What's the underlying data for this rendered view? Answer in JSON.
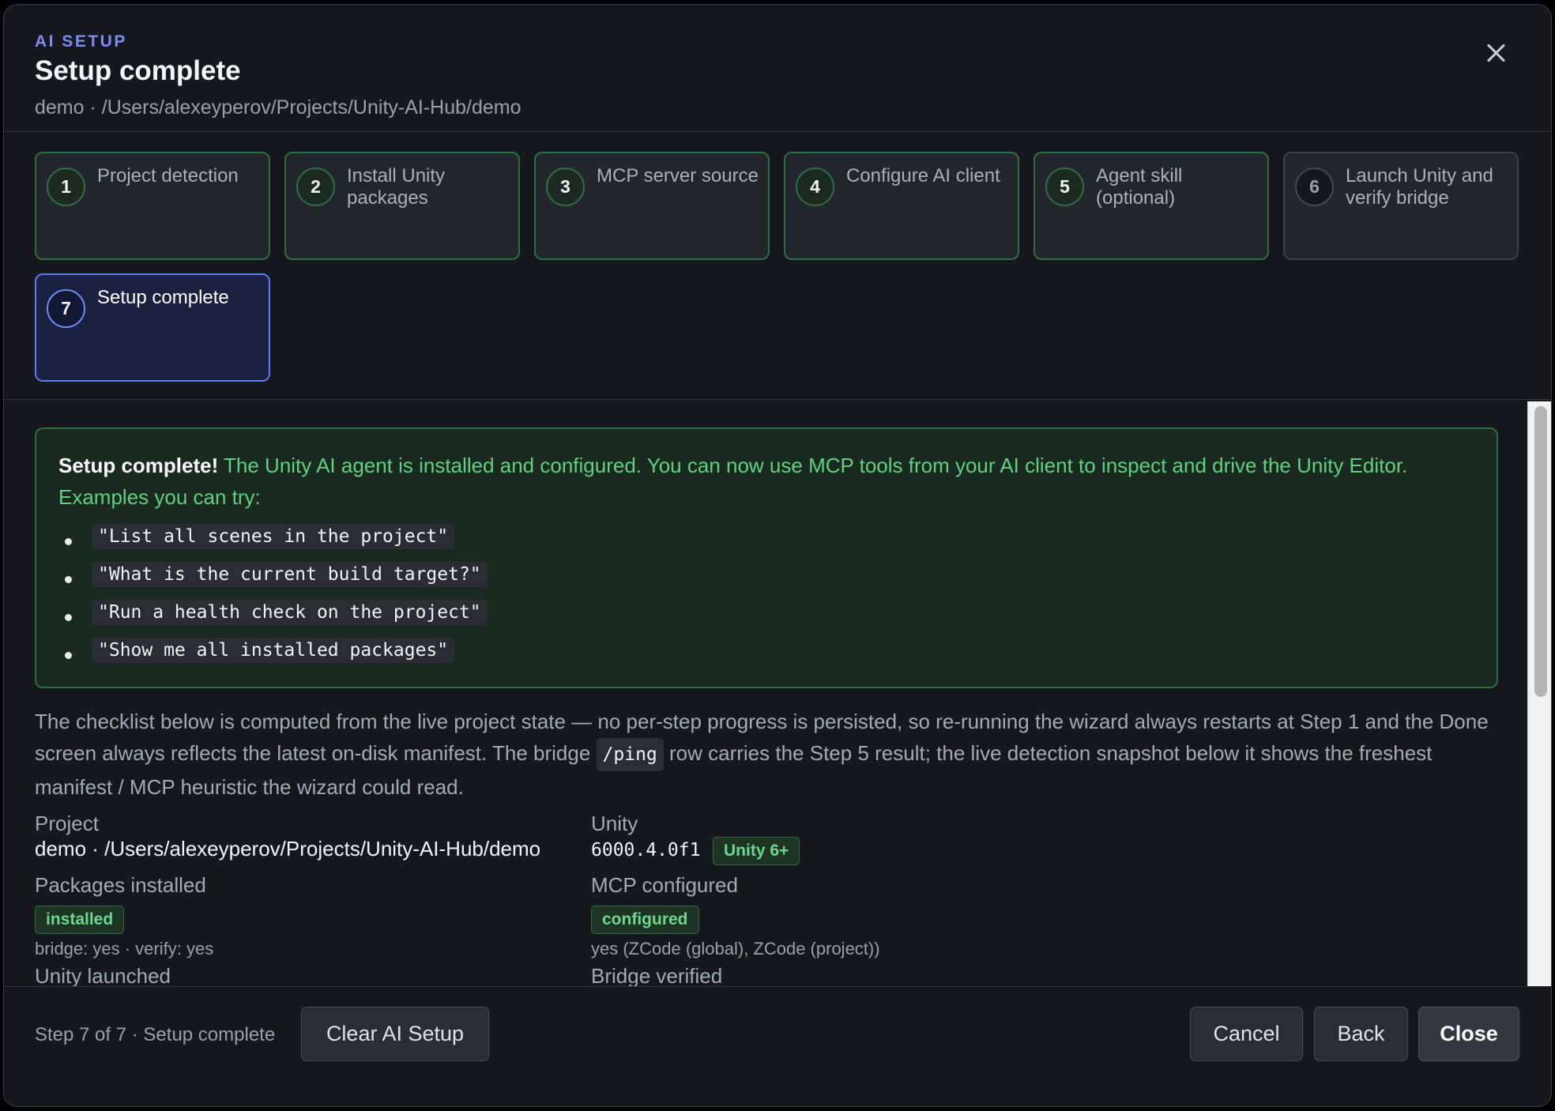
{
  "header": {
    "eyebrow": "AI SETUP",
    "title": "Setup complete",
    "subtitle": "demo · /Users/alexeyperov/Projects/Unity-AI-Hub/demo"
  },
  "steps": [
    {
      "num": "1",
      "label": "Project detection",
      "state": "done"
    },
    {
      "num": "2",
      "label": "Install Unity packages",
      "state": "done"
    },
    {
      "num": "3",
      "label": "MCP server source",
      "state": "done"
    },
    {
      "num": "4",
      "label": "Configure AI client",
      "state": "done"
    },
    {
      "num": "5",
      "label": "Agent skill (optional)",
      "state": "done"
    },
    {
      "num": "6",
      "label": "Launch Unity and verify bridge",
      "state": "pending"
    },
    {
      "num": "7",
      "label": "Setup complete",
      "state": "active"
    }
  ],
  "success": {
    "heading": "Setup complete!",
    "message": "The Unity AI agent is installed and configured. You can now use MCP tools from your AI client to inspect and drive the Unity Editor. Examples you can try:",
    "examples": [
      "\"List all scenes in the project\"",
      "\"What is the current build target?\"",
      "\"Run a health check on the project\"",
      "\"Show me all installed packages\""
    ]
  },
  "description": {
    "before_code": "The checklist below is computed from the live project state — no per-step progress is persisted, so re-running the wizard always restarts at Step 1 and the Done screen always reflects the latest on-disk manifest. The bridge",
    "code": "/ping",
    "after_code": "row carries the Step 5 result; the live detection snapshot below it shows the freshest manifest / MCP heuristic the wizard could read."
  },
  "checklist": {
    "project_label": "Project",
    "project_value": "demo · /Users/alexeyperov/Projects/Unity-AI-Hub/demo",
    "unity_label": "Unity",
    "unity_version": "6000.4.0f1",
    "unity_badge": "Unity 6+",
    "packages_label": "Packages installed",
    "packages_badge": "installed",
    "packages_detail": "bridge: yes · verify: yes",
    "mcp_label": "MCP configured",
    "mcp_badge": "configured",
    "mcp_detail": "yes (ZCode (global), ZCode (project))",
    "launched_label": "Unity launched",
    "bridge_label": "Bridge verified"
  },
  "footer": {
    "status": "Step 7 of 7 · Setup complete",
    "clear_label": "Clear AI Setup",
    "cancel_label": "Cancel",
    "back_label": "Back",
    "close_label": "Close"
  }
}
